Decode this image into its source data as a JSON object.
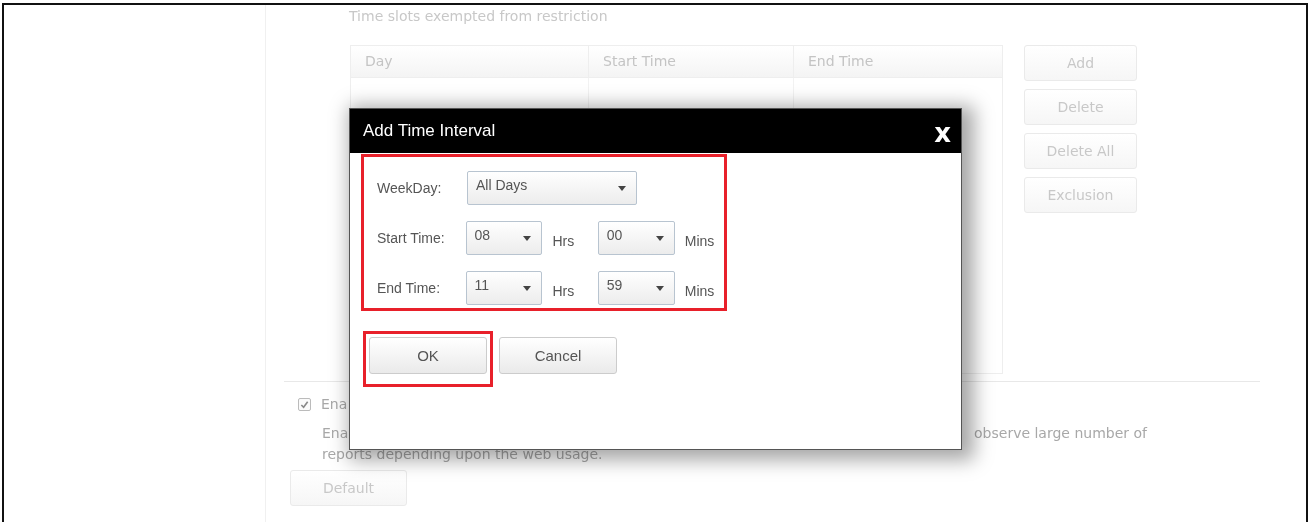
{
  "background": {
    "caption": "Time slots exempted from restriction",
    "table": {
      "columns": [
        "Day",
        "Start Time",
        "End Time"
      ]
    },
    "side_buttons": [
      "Add",
      "Delete",
      "Delete All",
      "Exclusion"
    ],
    "option": {
      "checked": true,
      "label": "Ena"
    },
    "description": {
      "left": "Ena",
      "right": "observe large number of",
      "line_2": "reports depending upon the web usage."
    },
    "default_button": "Default"
  },
  "dialog": {
    "title": "Add Time Interval",
    "close": "x",
    "fields_highlighted": true,
    "rows": [
      {
        "kind": "single",
        "label": "WeekDay:",
        "value": "All Days"
      },
      {
        "kind": "time",
        "label": "Start Time:",
        "hours": "08",
        "hours_unit": "Hrs",
        "minutes": "00",
        "minutes_unit": "Mins"
      },
      {
        "kind": "time",
        "label": "End Time:",
        "hours": "11",
        "hours_unit": "Hrs",
        "minutes": "59",
        "minutes_unit": "Mins"
      }
    ],
    "buttons": [
      {
        "label": "OK",
        "highlighted": true
      },
      {
        "label": "Cancel",
        "highlighted": false
      }
    ]
  }
}
